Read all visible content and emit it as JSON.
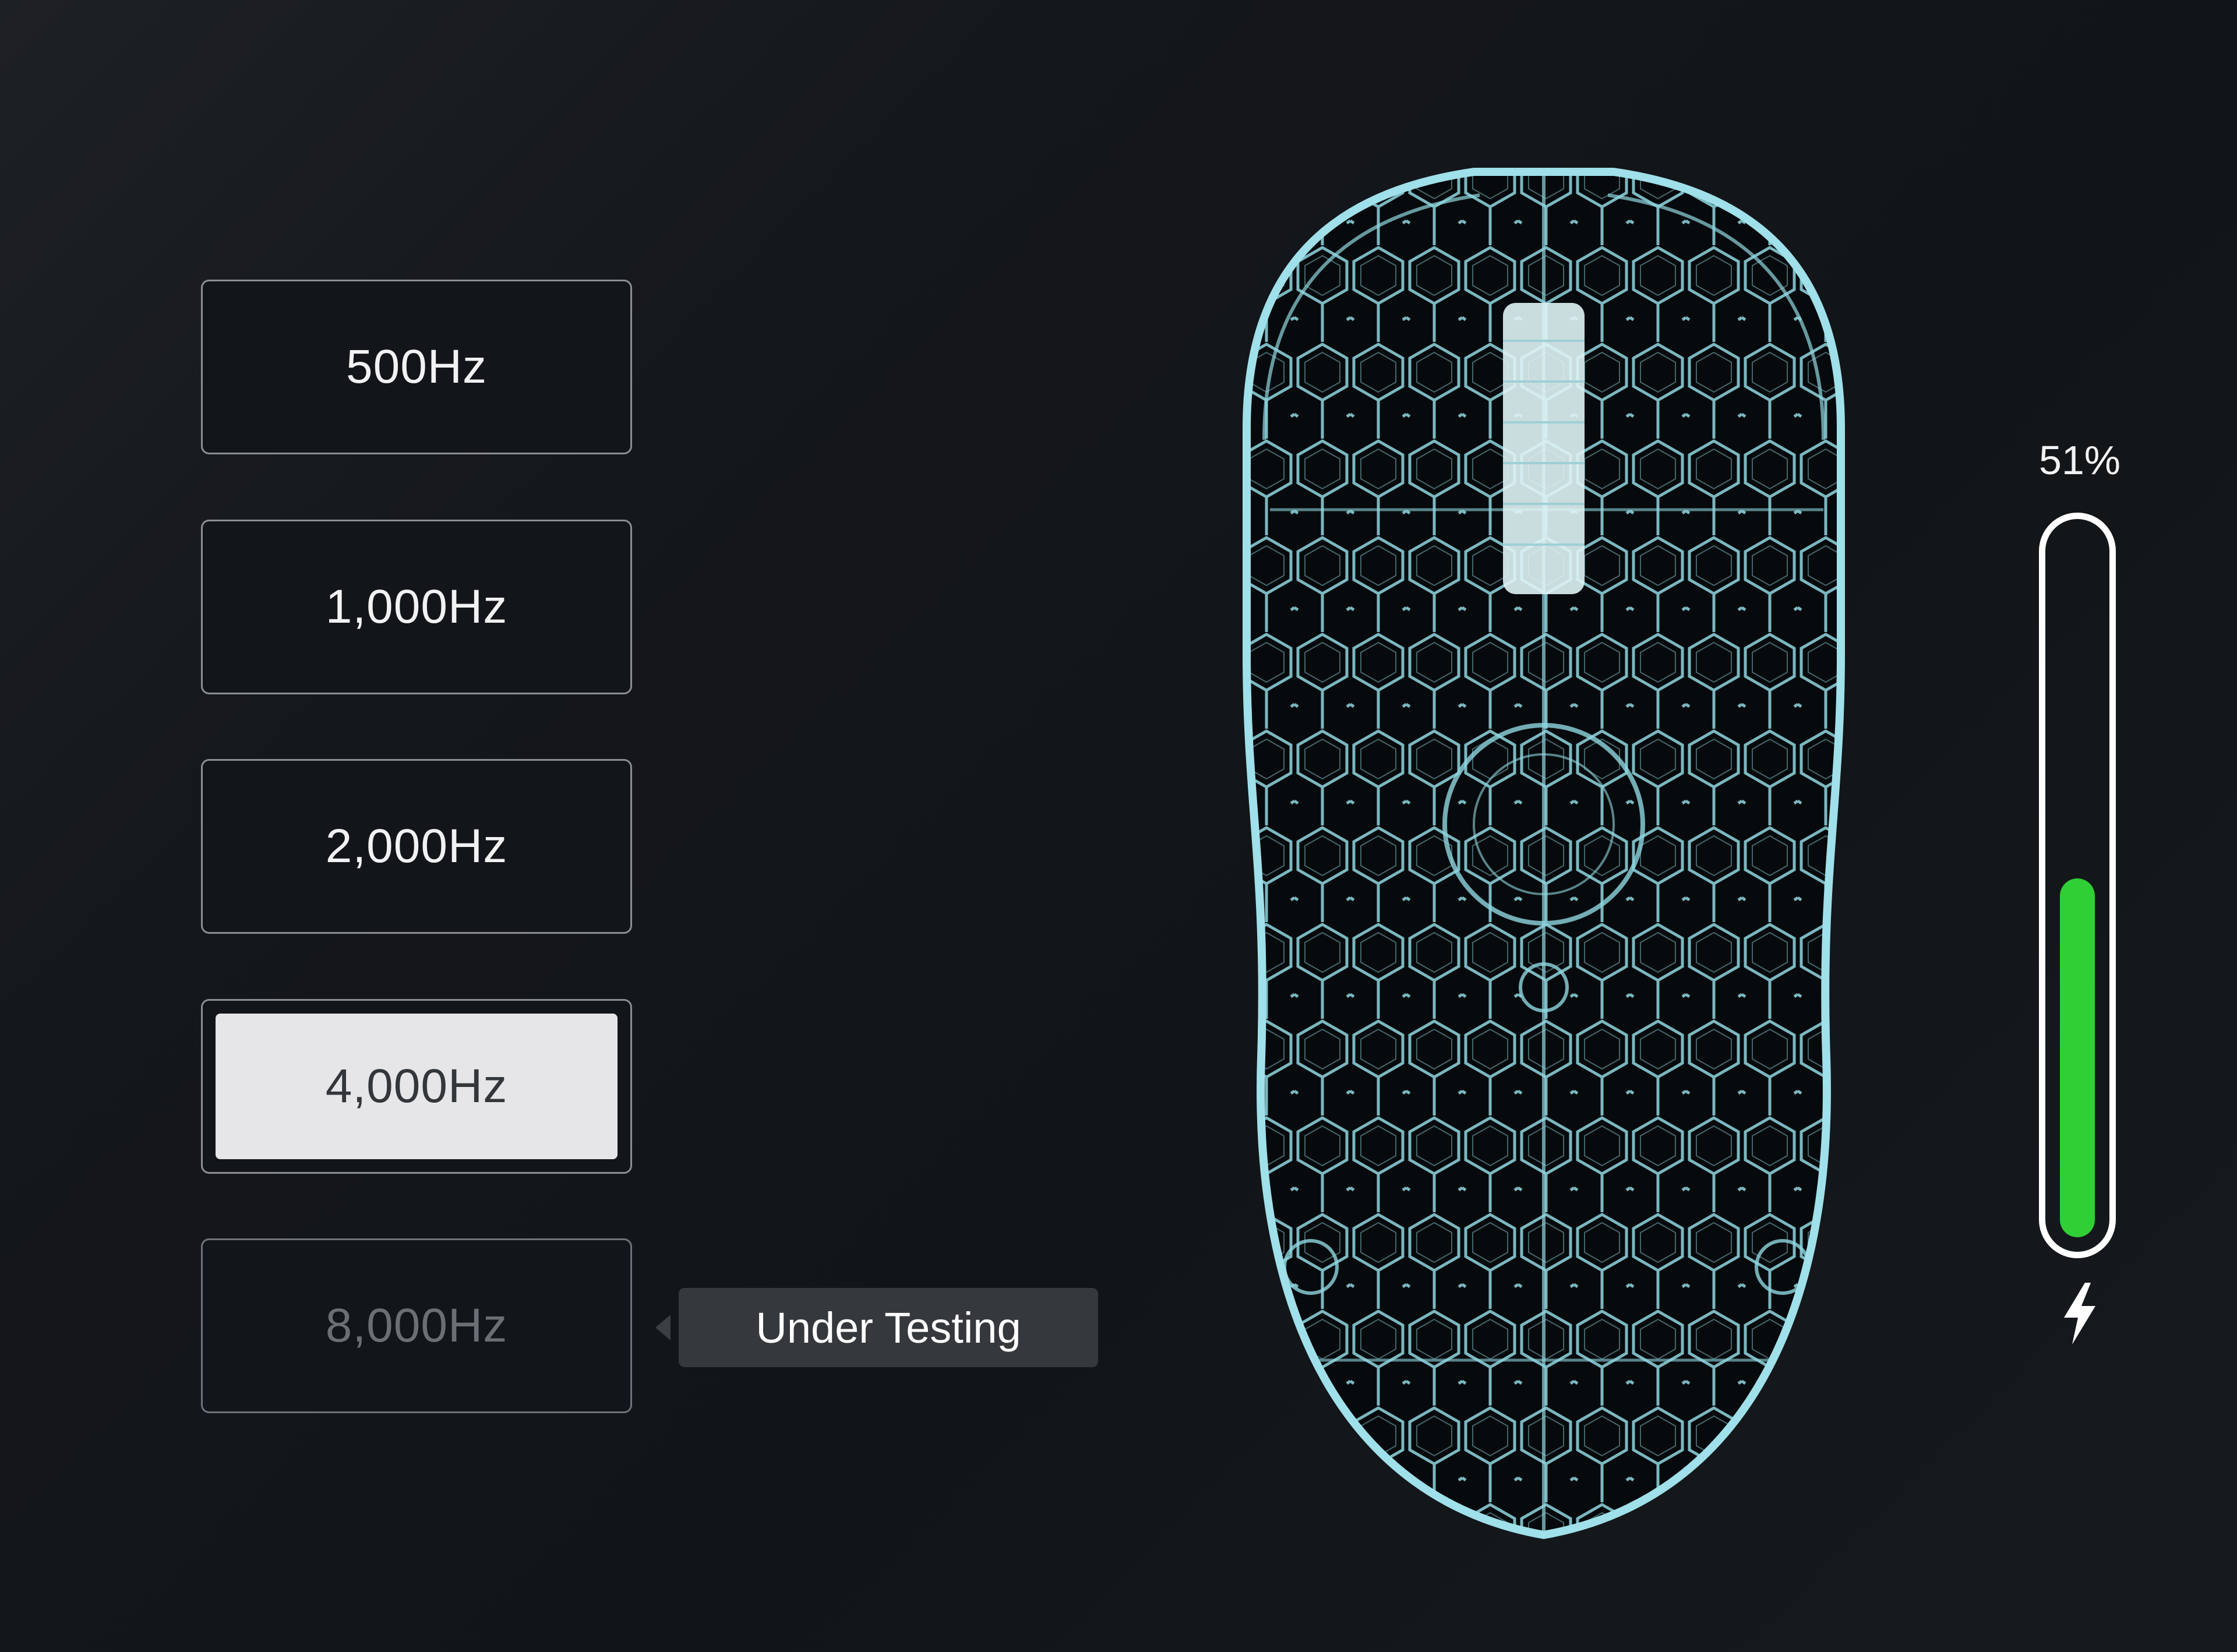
{
  "polling_rates": [
    {
      "label": "500Hz",
      "state": "default"
    },
    {
      "label": "1,000Hz",
      "state": "default"
    },
    {
      "label": "2,000Hz",
      "state": "default"
    },
    {
      "label": "4,000Hz",
      "state": "selected"
    },
    {
      "label": "8,000Hz",
      "state": "disabled"
    }
  ],
  "tooltip": {
    "text": "Under Testing"
  },
  "battery": {
    "percent_label": "51%",
    "level": 0.51,
    "charging": true,
    "fill_color": "#2fcf35"
  },
  "device": {
    "image": "x-ray-mouse-illustration",
    "accent_color": "#8fd6e0"
  }
}
